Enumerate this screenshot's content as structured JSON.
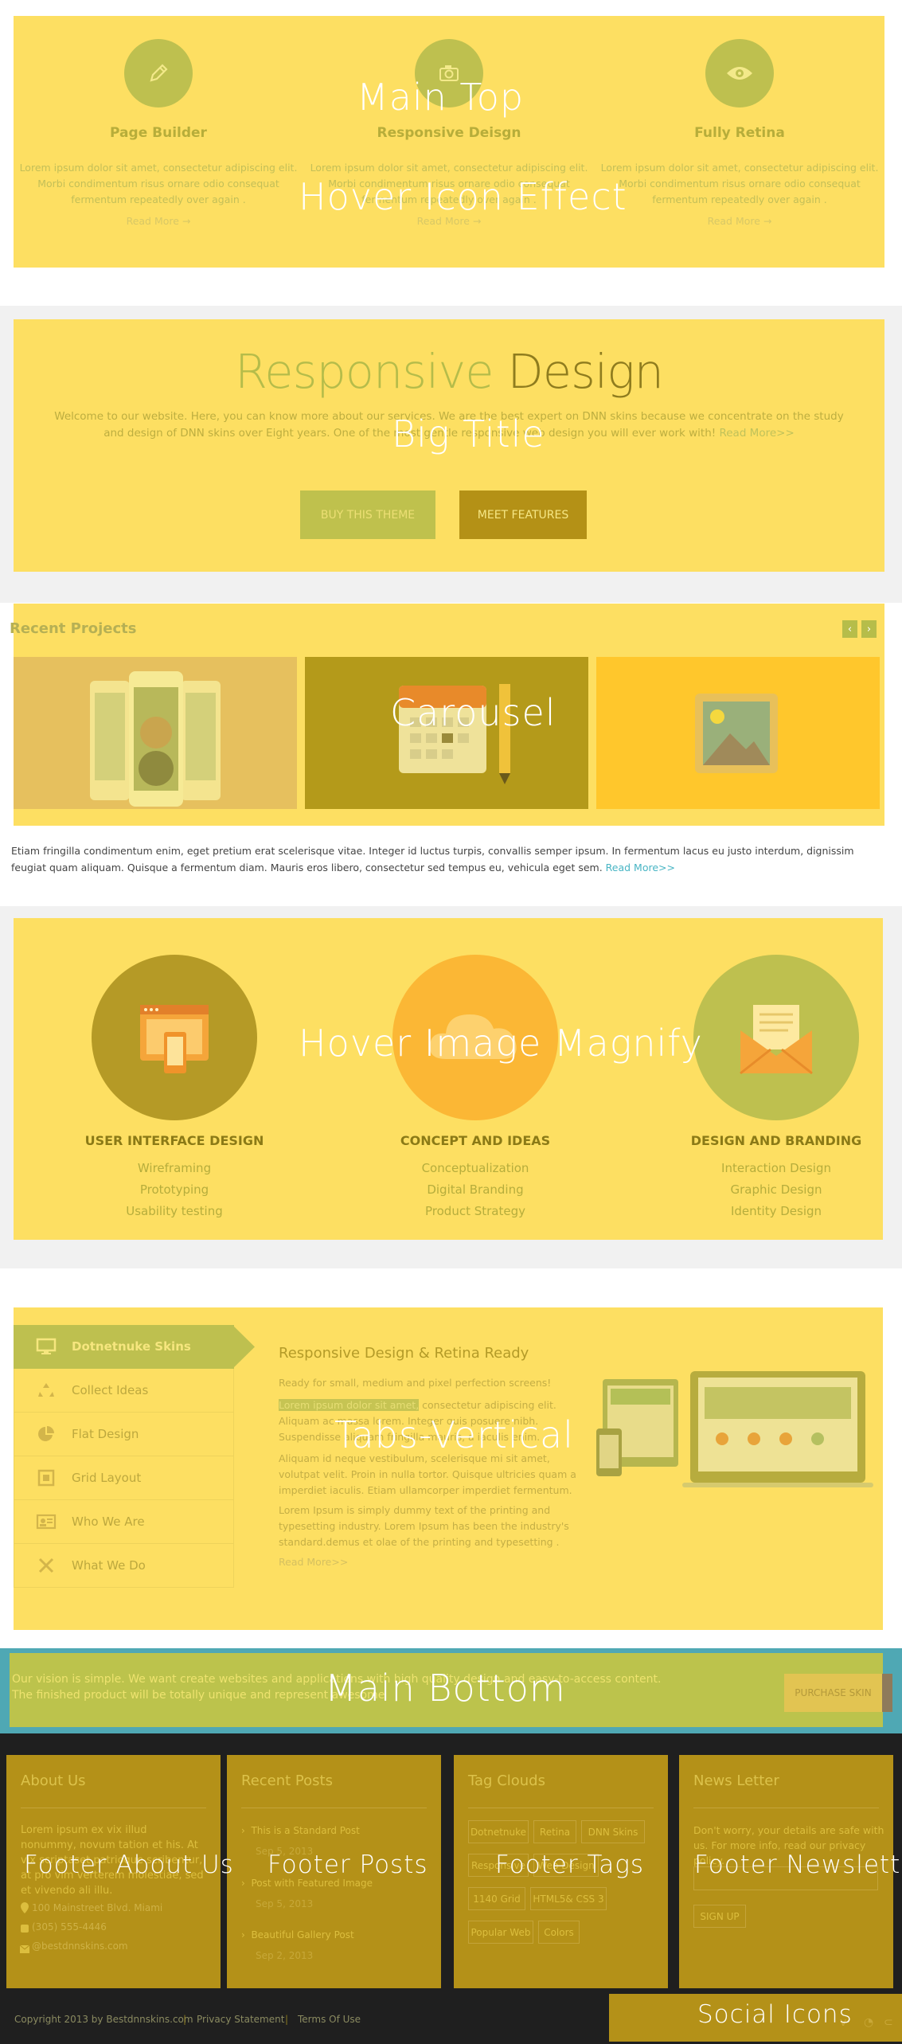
{
  "overlay_labels": {
    "main_top": "Main Top",
    "hover_icon": "Hover Icon Effect",
    "big_title": "Big Title",
    "carousel": "Carousel",
    "hover_image": "Hover Image Magnify",
    "tabs_vertical": "Tabs-Vertical",
    "main_bottom": "Main Bottom",
    "footer_about": "Footer About Us",
    "footer_posts": "Footer Posts",
    "footer_tags": "Footer Tags",
    "footer_newsletter": "Footer Newsletter",
    "social_icons": "Social Icons"
  },
  "features": [
    {
      "title": "Page Builder",
      "text": "Lorem ipsum dolor sit amet, consectetur adipiscing elit. Morbi condimentum risus ornare odio consequat fermentum repeatedly over again .",
      "more": "Read More →",
      "icon": "pencil-icon"
    },
    {
      "title": "Responsive Deisgn",
      "text": "Lorem ipsum dolor sit amet, consectetur adipiscing elit. Morbi condimentum risus ornare odio consequat fermentum repeatedly over again .",
      "more": "Read More →",
      "icon": "camera-icon"
    },
    {
      "title": "Fully Retina",
      "text": "Lorem ipsum dolor sit amet, consectetur adipiscing elit. Morbi condimentum risus ornare odio consequat fermentum repeatedly over again .",
      "more": "Read More →",
      "icon": "eye-icon"
    }
  ],
  "big_title": {
    "part1": "Responsive",
    "part2": "Design",
    "intro": "Welcome to our website. Here, you can know more about our services. We are the best expert on DNN skins because we concentrate on the study and design of DNN skins over Eight years. One of the most gentle responsive web design you will ever work with!",
    "read_more": "Read More>>",
    "btn_buy": "BUY THIS THEME",
    "btn_features": "MEET FEATURES"
  },
  "carousel": {
    "title": "Recent Projects",
    "prev": "‹",
    "next": "›",
    "description": "Etiam fringilla condimentum enim, eget pretium erat scelerisque vitae. Integer id luctus turpis, convallis semper ipsum. In fermentum lacus eu justo interdum, dignissim feugiat quam aliquam. Quisque a fermentum diam. Mauris eros libero, consectetur sed tempus eu, vehicula eget sem.",
    "read_more": "Read More>>"
  },
  "services": [
    {
      "title": "USER INTERFACE DESIGN",
      "items": [
        "Wireframing",
        "Prototyping",
        "Usability testing"
      ],
      "color": "#b59a26"
    },
    {
      "title": "CONCEPT AND IDEAS",
      "items": [
        "Conceptualization",
        "Digital Branding",
        "Product Strategy"
      ],
      "color": "#fbb735"
    },
    {
      "title": "DESIGN AND BRANDING",
      "items": [
        "Interaction Design",
        "Graphic Design",
        "Identity Design"
      ],
      "color": "#bec04f"
    }
  ],
  "tabs": {
    "items": [
      {
        "label": "Dotnetnuke Skins",
        "icon": "monitor-icon"
      },
      {
        "label": "Collect Ideas",
        "icon": "recycle-icon"
      },
      {
        "label": "Flat Design",
        "icon": "pie-chart-icon"
      },
      {
        "label": "Grid Layout",
        "icon": "grid-icon"
      },
      {
        "label": "Who We Are",
        "icon": "id-card-icon"
      },
      {
        "label": "What We Do",
        "icon": "tools-icon"
      }
    ],
    "content_title": "Responsive Design & Retina Ready",
    "p1": "Ready for small, medium and pixel perfection screens!",
    "p2_highlight": "Lorem ipsum dolor sit amet,",
    "p2_rest": " consectetur adipiscing elit. Aliquam ac massa lorem. Integer quis posuere nibh. Suspendisse aliquam fringilla mauris, a iaculis enim.",
    "p3": "Aliquam id neque vestibulum, scelerisque mi sit amet, volutpat velit. Proin in nulla tortor. Quisque ultricies quam a imperdiet iaculis. Etiam ullamcorper imperdiet fermentum.",
    "p4": "Lorem Ipsum is simply dummy text of the printing and typesetting industry. Lorem Ipsum has been the industry's standard.demus et olae of the printing and typesetting .",
    "read_more": "Read More>>"
  },
  "main_bottom": {
    "text": "Our vision is simple. We want create websites and applications with high quality design and easy-to-access content. The finished product will be totally unique and represent awesome",
    "button": "PURCHASE SKIN"
  },
  "footer": {
    "about": {
      "title": "About Us",
      "text": "Lorem ipsum ex vix illud nonummy, novum tation et his. At vix scriptaset patrioque scribentur, at pro vim verterem molestiae, sed et vivendo ali illu.",
      "address": "100 Mainstreet Blvd. Miami",
      "phone": "(305) 555-4446",
      "email": "@bestdnnskins.com"
    },
    "posts": {
      "title": "Recent Posts",
      "items": [
        {
          "title": "This is a Standard Post",
          "date": "Sep 5, 2013"
        },
        {
          "title": "Post with Featured Image",
          "date": "Sep 5, 2013"
        },
        {
          "title": "Beautiful Gallery Post",
          "date": "Sep 2, 2013"
        }
      ]
    },
    "tags": {
      "title": "Tag Clouds",
      "items": [
        "Dotnetnuke",
        "Retina",
        "DNN Skins",
        "Responsive",
        "Web Design",
        "1140 Grid",
        "HTML5& CSS 3",
        "Popular Web",
        "Colors"
      ]
    },
    "newsletter": {
      "title": "News Letter",
      "text": "Don't worry, your details are safe with us. For more info, read our privacy policy.",
      "button": "SIGN UP"
    },
    "copyright": "Copyright 2013 by Bestdnnskins.com",
    "privacy": "Privacy Statement",
    "terms": "Terms Of Use",
    "separator": "|"
  }
}
